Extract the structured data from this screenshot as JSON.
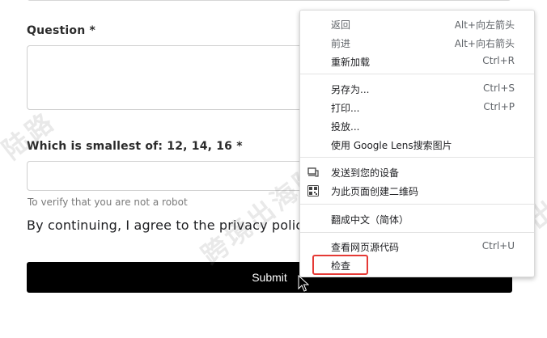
{
  "form": {
    "question_label": "Question *",
    "captcha_label": "Which is smallest of: 12, 14, 16 *",
    "captcha_hint": "To verify that you are not a robot",
    "consent_text": "By continuing, I agree to the privacy policy a",
    "submit_label": "Submit"
  },
  "watermarks": [
    "陆路",
    "跨境出海陆路",
    "跨境出",
    "跨境出海陆路"
  ],
  "context_menu": {
    "items": [
      {
        "label": "返回",
        "shortcut": "Alt+向左箭头"
      },
      {
        "label": "前进",
        "shortcut": "Alt+向右箭头"
      },
      {
        "label": "重新加载",
        "shortcut": "Ctrl+R"
      },
      {
        "label": "另存为...",
        "shortcut": "Ctrl+S"
      },
      {
        "label": "打印...",
        "shortcut": "Ctrl+P"
      },
      {
        "label": "投放...",
        "shortcut": ""
      },
      {
        "label": "使用 Google Lens搜索图片",
        "shortcut": ""
      },
      {
        "label": "发送到您的设备",
        "shortcut": "",
        "icon": "devices-icon"
      },
      {
        "label": "为此页面创建二维码",
        "shortcut": "",
        "icon": "qr-code-icon"
      },
      {
        "label": "翻成中文（简体）",
        "shortcut": ""
      },
      {
        "label": "查看网页源代码",
        "shortcut": "Ctrl+U"
      },
      {
        "label": "检查",
        "shortcut": ""
      }
    ],
    "highlight_color": "#e53935"
  }
}
